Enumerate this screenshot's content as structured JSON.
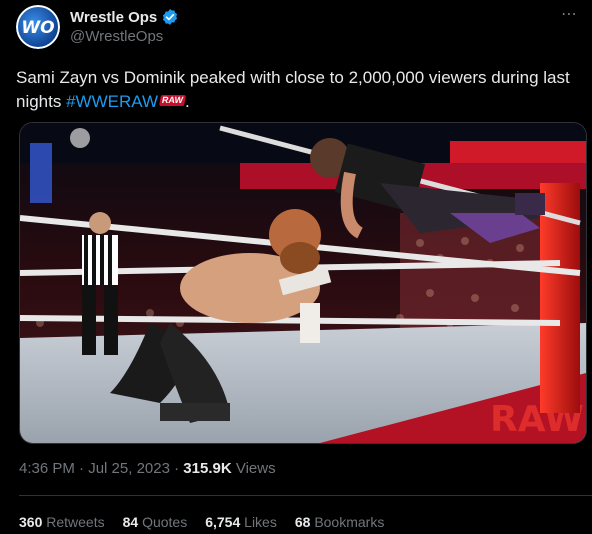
{
  "author": {
    "name": "Wrestle Ops",
    "handle": "@WrestleOps",
    "avatar_text": "WO"
  },
  "more_icon": "⋯",
  "tweet": {
    "text_before": "Sami Zayn vs Dominik peaked with close to 2,000,000 viewers during last nights ",
    "hashtag": "#WWERAW",
    "raw_badge": "RAW",
    "text_after": "."
  },
  "media": {
    "scene": "wrestling-ring-photo",
    "apron_text": "RAW"
  },
  "meta": {
    "time": "4:36 PM",
    "date": "Jul 25, 2023",
    "sep": "·",
    "views_count": "315.9K",
    "views_label": "Views"
  },
  "stats": [
    {
      "count": "360",
      "label": "Retweets"
    },
    {
      "count": "84",
      "label": "Quotes"
    },
    {
      "count": "6,754",
      "label": "Likes"
    },
    {
      "count": "68",
      "label": "Bookmarks"
    }
  ],
  "colors": {
    "background": "#000000",
    "text": "#e7e9ea",
    "muted": "#71767b",
    "link": "#1d9bf0",
    "verified": "#1d9bf0"
  }
}
